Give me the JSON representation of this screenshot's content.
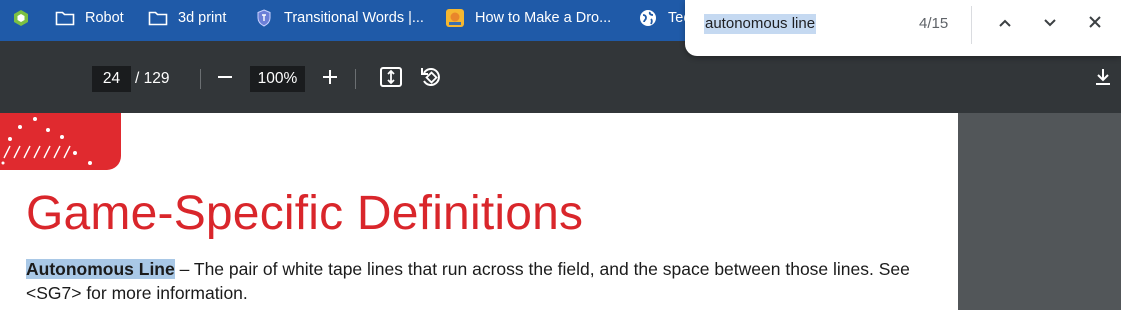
{
  "bookmarks": {
    "items": [
      {
        "label": "Robot",
        "icon": "folder-icon"
      },
      {
        "label": "3d print",
        "icon": "folder-icon"
      },
      {
        "label": "Transitional Words |...",
        "icon": "shield-favicon"
      },
      {
        "label": "How to Make a Dro...",
        "icon": "site-favicon"
      },
      {
        "label": "Tee",
        "icon": "globe-icon"
      }
    ]
  },
  "toolbar": {
    "page_current": "24",
    "page_total": "/ 129",
    "zoom": "100%"
  },
  "find": {
    "query": "autonomous line",
    "count": "4/15"
  },
  "document": {
    "title": "Game-Specific Definitions",
    "term": "Autonomous Line",
    "definition_text": " – The pair of white tape lines that run across the field, and the space between those lines. See <SG7> for more information."
  },
  "colors": {
    "bookmarks_bg": "#1f5aa8",
    "toolbar_bg": "#323639",
    "title_red": "#d9262b",
    "highlight": "#a9c8e6"
  }
}
